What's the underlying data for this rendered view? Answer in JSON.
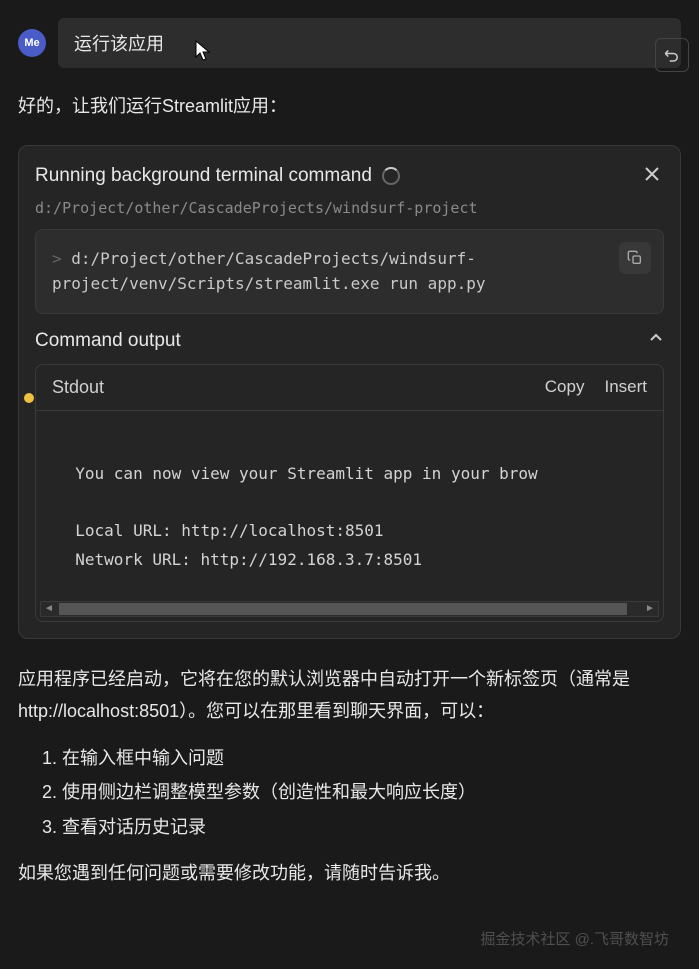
{
  "header": {
    "avatar_label": "Me",
    "input_text": "运行该应用"
  },
  "assistant": {
    "intro": "好的，让我们运行Streamlit应用：",
    "terminal": {
      "title": "Running background terminal command",
      "path": "d:/Project/other/CascadeProjects/windsurf-project",
      "command": "d:/Project/other/CascadeProjects/windsurf-project/venv/Scripts/streamlit.exe run app.py",
      "output_title": "Command output",
      "stdout_label": "Stdout",
      "copy_label": "Copy",
      "insert_label": "Insert",
      "stdout_content": "\n  You can now view your Streamlit app in your brow\n\n  Local URL: http://localhost:8501\n  Network URL: http://192.168.3.7:8501\n"
    },
    "explain_1": "应用程序已经启动，它将在您的默认浏览器中自动打开一个新标签页（通常是 http://localhost:8501）。您可以在那里看到聊天界面，可以：",
    "steps": [
      "在输入框中输入问题",
      "使用侧边栏调整模型参数（创造性和最大响应长度）",
      "查看对话历史记录"
    ],
    "explain_2": "如果您遇到任何问题或需要修改功能，请随时告诉我。"
  },
  "watermark": "掘金技术社区 @.飞哥数智坊"
}
